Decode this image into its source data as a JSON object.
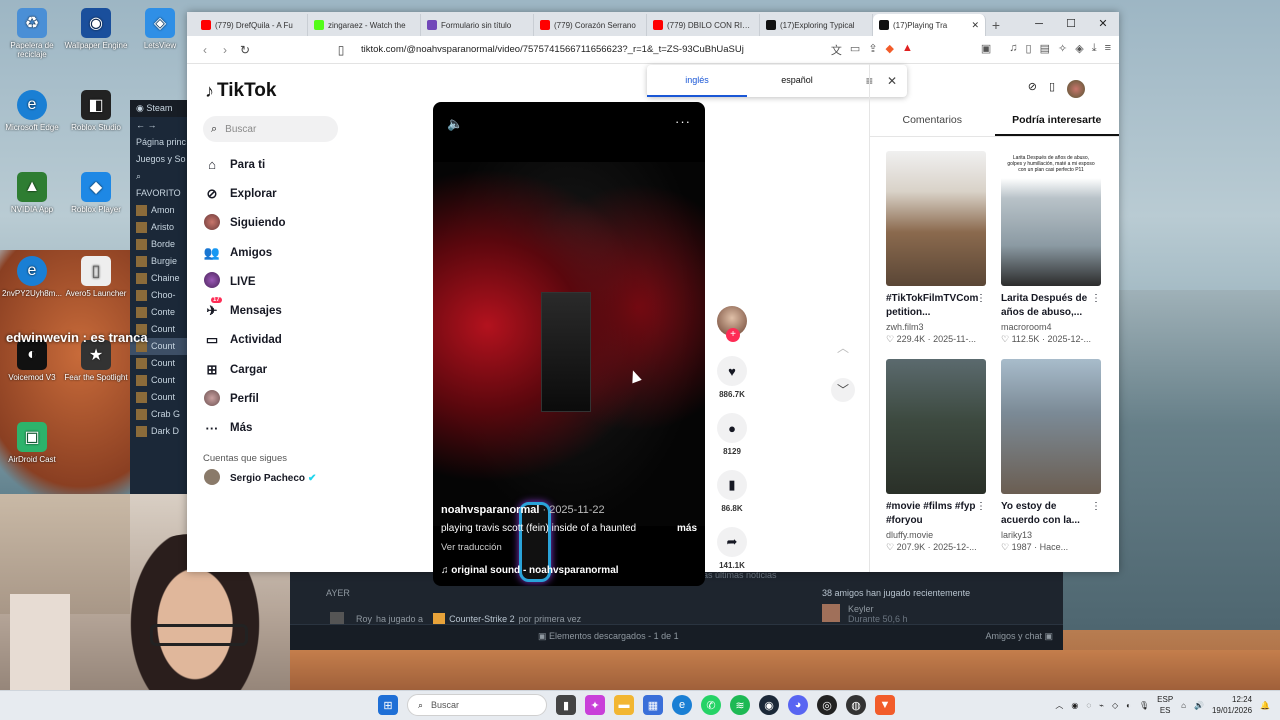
{
  "desktop": {
    "icons": [
      {
        "label": "Papelera de reciclaje",
        "icon": "recycle-bin-icon",
        "color": "#4a8fd6"
      },
      {
        "label": "Wallpaper Engine",
        "icon": "wallpaper-engine-icon",
        "color": "#1a4f9c"
      },
      {
        "label": "LetsView",
        "icon": "letsview-icon",
        "color": "#2f8fe6"
      },
      {
        "label": "Microsoft Edge",
        "icon": "edge-icon",
        "color": "#1a7fd4"
      },
      {
        "label": "Roblox Studio",
        "icon": "roblox-studio-icon",
        "color": "#222222"
      },
      {
        "label": "NVIDIA App",
        "icon": "nvidia-icon",
        "color": "#2e7d32"
      },
      {
        "label": "Roblox Player",
        "icon": "roblox-player-icon",
        "color": "#1e88e5"
      },
      {
        "label": "2nvPY2Uyh8m...",
        "icon": "edge-icon",
        "color": "#1a7fd4"
      },
      {
        "label": "Avero5 Launcher",
        "icon": "document-icon",
        "color": "#eeeeee"
      },
      {
        "label": "Voicemod V3",
        "icon": "voicemod-icon",
        "color": "#111111"
      },
      {
        "label": "Fear the Spotlight",
        "icon": "game-icon",
        "color": "#333333"
      },
      {
        "label": "AirDroid Cast",
        "icon": "airdroid-icon",
        "color": "#2db36b"
      }
    ],
    "overlay_text": "edwinwevin : es tranca"
  },
  "steam": {
    "title": "Steam",
    "items": [
      "Página princ",
      "Juegos y So",
      "FAVORITO",
      "Amon",
      "Aristo",
      "Borde",
      "Burgie",
      "Chaine",
      "Choo-",
      "Conte",
      "Count",
      "Count",
      "Count",
      "Count",
      "Count",
      "Crab G",
      "Dark D"
    ],
    "bottom": {
      "section": "AYER",
      "activity_user": "Roy",
      "activity_text": "ha jugado a",
      "activity_game": "Counter-Strike 2",
      "activity_suffix": "por primera vez",
      "news_link": "ver las últimas noticias",
      "friends_played": "38 amigos han jugado recientemente",
      "friend_name": "Keyler",
      "friend_status": "Durante 50,6 h",
      "downloads": "Elementos descargados - 1 de 1",
      "friends_chat": "Amigos y chat"
    }
  },
  "browser": {
    "tabs": [
      {
        "label": "(779) DrefQuila - A Fu",
        "color": "#ff0000"
      },
      {
        "label": "zingaraez - Watch the",
        "color": "#53fc18"
      },
      {
        "label": "Formulario sin título",
        "color": "#7248b9"
      },
      {
        "label": "(779) Corazón Serrano",
        "color": "#ff0000"
      },
      {
        "label": "(779) DBILO CON RITM",
        "color": "#ff0000"
      },
      {
        "label": "(17)Exploring Typical",
        "color": "#111111"
      },
      {
        "label": "(17)Playing Tra",
        "color": "#111111"
      }
    ],
    "url": "tiktok.com/@noahvsparanormal/video/7575741566711656623?_r=1&_t=ZS-93CuBhUaSUj"
  },
  "translate_bar": {
    "from": "inglés",
    "to": "español"
  },
  "tiktok": {
    "logo": "TikTok",
    "search_placeholder": "Buscar",
    "nav": [
      {
        "label": "Para ti",
        "icon": "home-icon"
      },
      {
        "label": "Explorar",
        "icon": "compass-icon"
      },
      {
        "label": "Siguiendo",
        "icon": "following-avatar-icon"
      },
      {
        "label": "Amigos",
        "icon": "friends-icon"
      },
      {
        "label": "LIVE",
        "icon": "live-icon"
      },
      {
        "label": "Mensajes",
        "icon": "messages-icon",
        "badge": "17"
      },
      {
        "label": "Actividad",
        "icon": "activity-icon"
      },
      {
        "label": "Cargar",
        "icon": "upload-icon"
      },
      {
        "label": "Perfil",
        "icon": "profile-avatar-icon"
      },
      {
        "label": "Más",
        "icon": "more-icon"
      }
    ],
    "following_title": "Cuentas que sigues",
    "following_first": "Sergio Pacheco",
    "video": {
      "username": "noahvsparanormal",
      "date": " · 2025-11-22",
      "description": "playing travis scott (fein) inside of a haunted",
      "more": "más",
      "translate": "Ver traducción",
      "sound": "original sound - noahvsparanormal"
    },
    "actions": {
      "likes": "886.7K",
      "comments": "8129",
      "saves": "86.8K",
      "shares": "141.1K"
    },
    "right_tabs": [
      "Comentarios",
      "Podría interesarte"
    ],
    "recommendations": [
      {
        "title": "#TikTokFilmTVCom petition...",
        "user": "zwh.film3",
        "likes": "229.4K",
        "date": "2025-11-...",
        "thumb_text": "",
        "bg": "#6b5a48"
      },
      {
        "title": "Larita Después de años de abuso,...",
        "user": "macroroom4",
        "likes": "112.5K",
        "date": "2025-12-...",
        "thumb_text": "Larita Después de años de abuso, golpes y humillación, maté a mi esposo con un plan casi perfecto P11",
        "bg": "#9aa7b0"
      },
      {
        "title": "#movie #films #fyp #foryou",
        "user": "dluffy.movie",
        "likes": "207.9K",
        "date": "2025-12-...",
        "thumb_text": "",
        "bg": "#3d4a40"
      },
      {
        "title": "Yo estoy de acuerdo con la...",
        "user": "lariky13",
        "likes": "1987",
        "date": "Hace...",
        "thumb_text": "",
        "bg": "#7b8a96"
      }
    ]
  },
  "taskbar": {
    "search_placeholder": "Buscar",
    "lang": "ESP",
    "lang_sub": "ES",
    "time": "12:24",
    "date": "19/01/2026"
  }
}
